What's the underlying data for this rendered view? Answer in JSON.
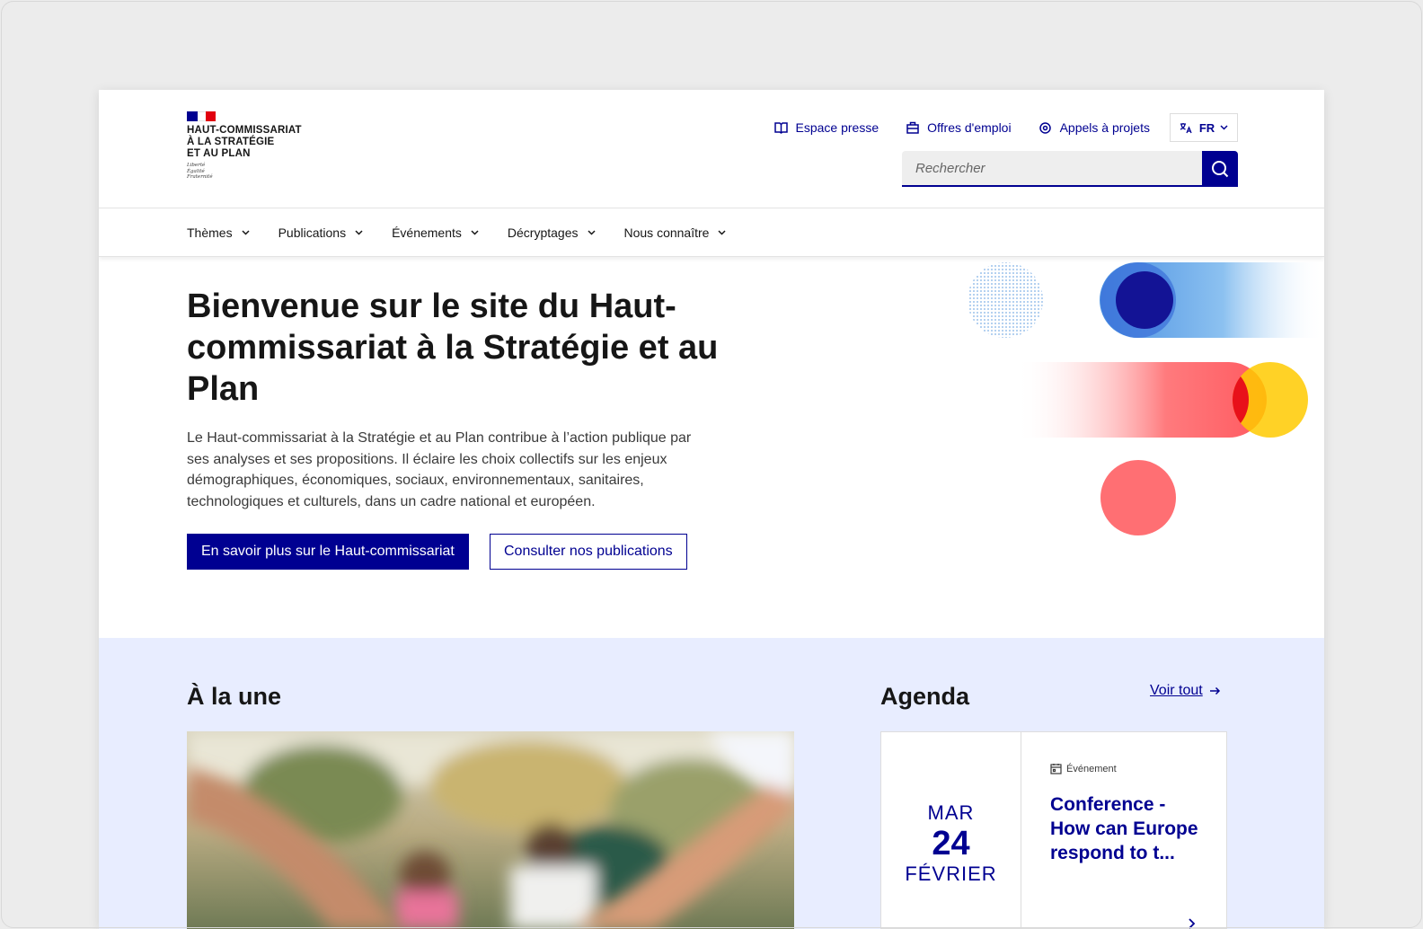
{
  "header": {
    "logo": {
      "lines": [
        "HAUT-COMMISSARIAT",
        "À LA STRATÉGIE",
        "ET AU PLAN"
      ],
      "motto": [
        "Liberté",
        "Égalité",
        "Fraternité"
      ]
    },
    "quick_links": [
      {
        "label": "Espace presse",
        "icon": "book-icon"
      },
      {
        "label": "Offres d'emploi",
        "icon": "briefcase-icon"
      },
      {
        "label": "Appels à projets",
        "icon": "eye-icon"
      }
    ],
    "language": "FR",
    "search": {
      "placeholder": "Rechercher"
    }
  },
  "nav": {
    "items": [
      "Thèmes",
      "Publications",
      "Événements",
      "Décryptages",
      "Nous connaître"
    ]
  },
  "hero": {
    "title": "Bienvenue sur le site du Haut-commissariat à la Stratégie et au Plan",
    "text": "Le Haut-commissariat à la Stratégie et au Plan contribue à l’action publique par ses analyses et ses propositions. Il éclaire les choix collectifs sur les enjeux démographiques, économiques, sociaux, environnementaux, sanitaires, technologiques et culturels, dans un cadre national et européen.",
    "primary_button": "En savoir plus sur le Haut-commissariat",
    "secondary_button": "Consulter nos publications"
  },
  "une": {
    "title": "À la une"
  },
  "agenda": {
    "title": "Agenda",
    "see_all": "Voir tout",
    "event": {
      "day_of_week": "MAR",
      "day": "24",
      "month": "FÉVRIER",
      "tag": "Événement",
      "title": "Conference - How can Europe respond to t..."
    }
  },
  "colors": {
    "primary": "#000091",
    "section_bg": "#e8edff",
    "accent_red": "#ff5655",
    "accent_yellow": "#ffca00",
    "accent_blue": "#6fa8e8"
  }
}
